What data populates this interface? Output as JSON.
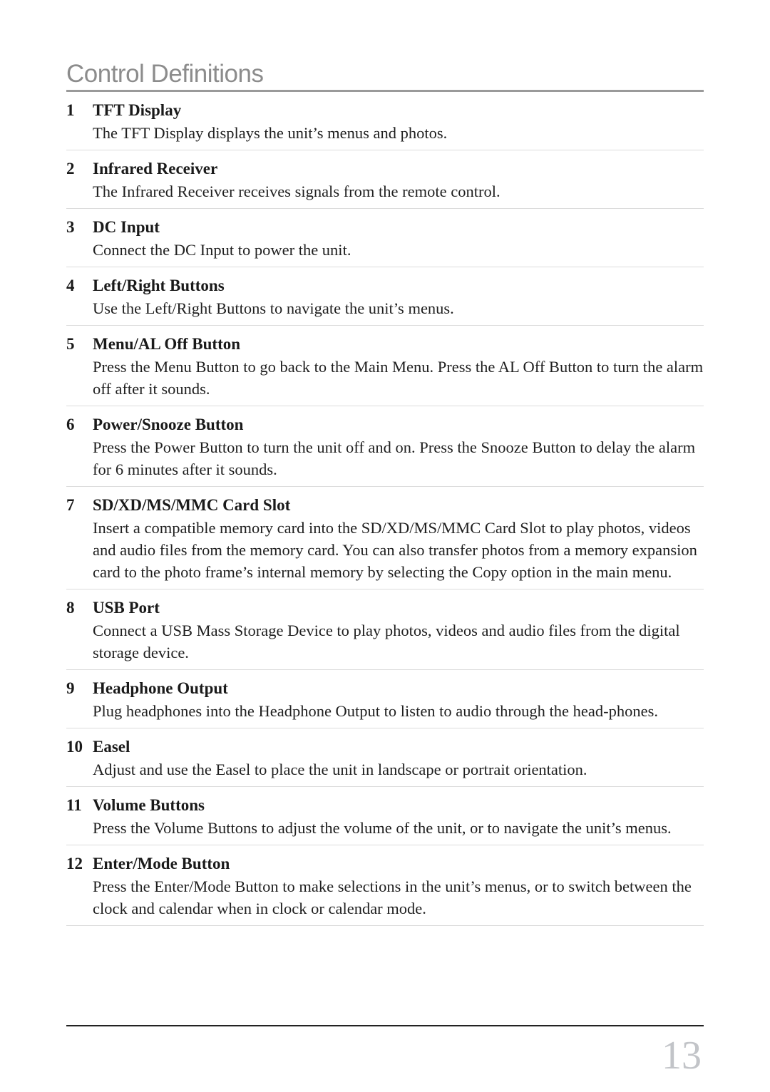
{
  "page": {
    "title": "Control Definitions",
    "page_number": "13"
  },
  "items": [
    {
      "num": "1",
      "title": "TFT Display",
      "desc": "The TFT Display displays the unit’s menus and photos."
    },
    {
      "num": "2",
      "title": "Infrared Receiver",
      "desc": "The Infrared Receiver receives signals from the remote control."
    },
    {
      "num": "3",
      "title": "DC Input",
      "desc": "Connect the DC Input to power the unit."
    },
    {
      "num": "4",
      "title": "Left/Right Buttons",
      "desc": "Use the Left/Right Buttons to navigate the unit’s menus."
    },
    {
      "num": "5",
      "title": "Menu/AL Off Button",
      "desc": "Press the Menu Button to go back to the Main Menu.  Press the AL Off Button to turn the alarm off after it sounds."
    },
    {
      "num": "6",
      "title": "Power/Snooze Button",
      "desc": "Press the Power Button to turn the unit off and on.  Press the Snooze Button to delay the alarm for 6 minutes after it sounds."
    },
    {
      "num": "7",
      "title": "SD/XD/MS/MMC Card Slot",
      "desc": "Insert a compatible memory card into the SD/XD/MS/MMC Card Slot to play photos, videos and audio files from the memory card. You can also transfer photos from a memory expansion card to the photo frame’s internal memory by selecting the Copy option in the main menu."
    },
    {
      "num": "8",
      "title": "USB Port",
      "desc": "Connect a USB Mass Storage Device to play photos, videos and audio files from the digital storage device."
    },
    {
      "num": "9",
      "title": "Headphone Output",
      "desc": "Plug headphones into the Headphone Output to listen to audio through the head-phones."
    },
    {
      "num": "10",
      "title": "Easel",
      "desc": "Adjust and use the Easel to place the unit in landscape or portrait orientation."
    },
    {
      "num": "11",
      "title": "Volume Buttons",
      "desc": "Press the Volume Buttons to adjust the volume of the unit, or to navigate the unit’s menus."
    },
    {
      "num": "12",
      "title": "Enter/Mode Button",
      "desc": "Press the Enter/Mode Button to make selections in the unit’s menus, or to switch between the clock and calendar when in clock or calendar mode."
    }
  ]
}
